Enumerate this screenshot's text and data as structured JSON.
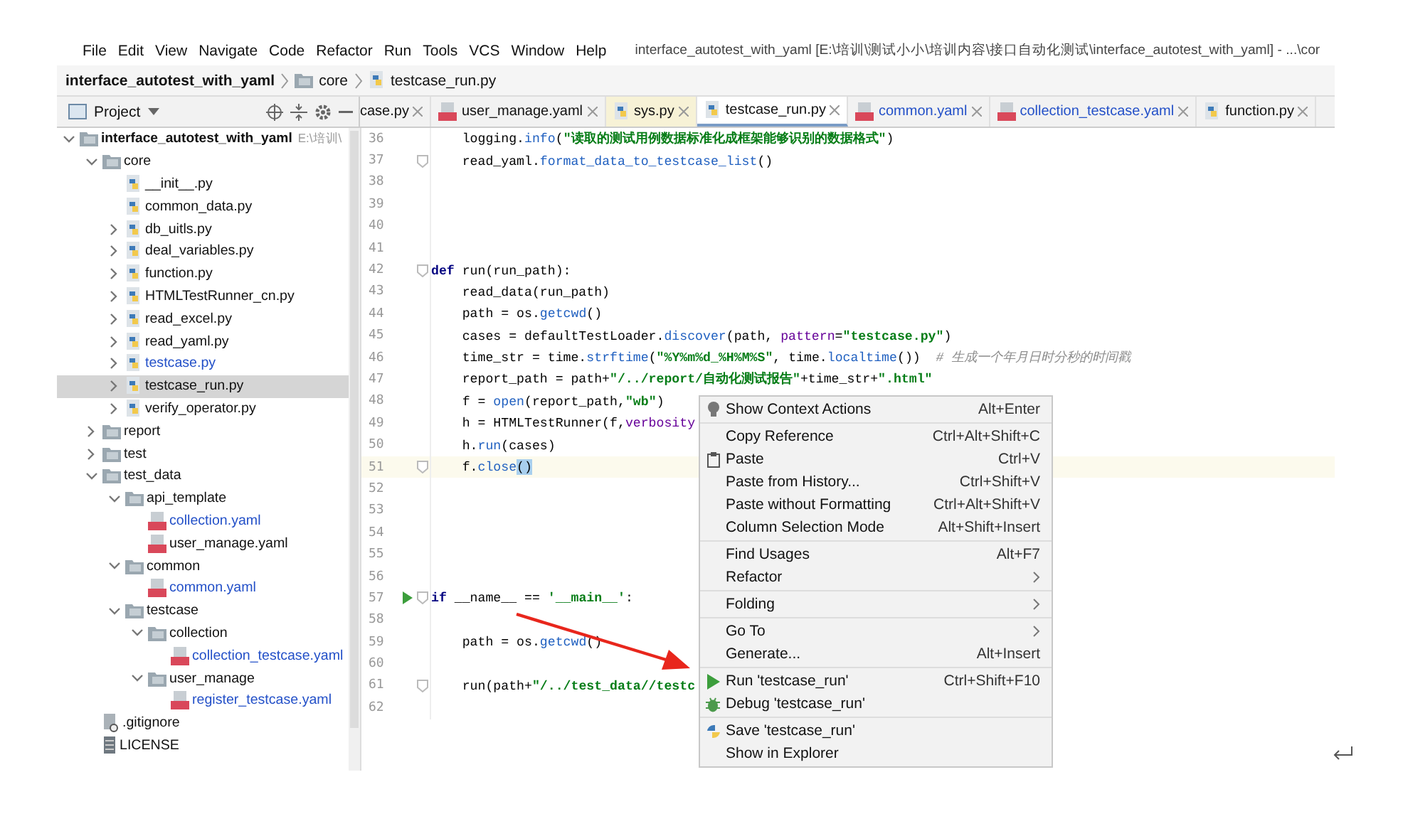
{
  "menu_bar": {
    "items": [
      "File",
      "Edit",
      "View",
      "Navigate",
      "Code",
      "Refactor",
      "Run",
      "Tools",
      "VCS",
      "Window",
      "Help"
    ],
    "title": "interface_autotest_with_yaml [E:\\培训\\测试小小\\培训内容\\接口自动化测试\\interface_autotest_with_yaml] - ...\\cor"
  },
  "breadcrumb": [
    "interface_autotest_with_yaml",
    "core",
    "testcase_run.py"
  ],
  "project_panel": {
    "title": "Project",
    "tree": [
      {
        "name": "interface_autotest_with_yaml",
        "hint": "E:\\培训\\",
        "kind": "folder",
        "expanded": true,
        "selected": false,
        "modified": false,
        "children": [
          {
            "name": "core",
            "kind": "folder",
            "expanded": true,
            "selected": false,
            "modified": false,
            "children": [
              {
                "name": "__init__.py",
                "kind": "py",
                "selected": false,
                "modified": false
              },
              {
                "name": "common_data.py",
                "kind": "py",
                "selected": false,
                "modified": false
              },
              {
                "name": "db_uitls.py",
                "kind": "py",
                "expanded": false,
                "selected": false,
                "modified": false
              },
              {
                "name": "deal_variables.py",
                "kind": "py",
                "expanded": false,
                "selected": false,
                "modified": false
              },
              {
                "name": "function.py",
                "kind": "py",
                "expanded": false,
                "selected": false,
                "modified": false
              },
              {
                "name": "HTMLTestRunner_cn.py",
                "kind": "py",
                "expanded": false,
                "selected": false,
                "modified": false
              },
              {
                "name": "read_excel.py",
                "kind": "py",
                "expanded": false,
                "selected": false,
                "modified": false
              },
              {
                "name": "read_yaml.py",
                "kind": "py",
                "expanded": false,
                "selected": false,
                "modified": false
              },
              {
                "name": "testcase.py",
                "kind": "py",
                "expanded": false,
                "selected": false,
                "modified": true
              },
              {
                "name": "testcase_run.py",
                "kind": "py",
                "expanded": false,
                "selected": true,
                "modified": false
              },
              {
                "name": "verify_operator.py",
                "kind": "py",
                "expanded": false,
                "selected": false,
                "modified": false
              }
            ]
          },
          {
            "name": "report",
            "kind": "folder",
            "expanded": false,
            "selected": false,
            "modified": false
          },
          {
            "name": "test",
            "kind": "folder",
            "expanded": false,
            "selected": false,
            "modified": false
          },
          {
            "name": "test_data",
            "kind": "folder",
            "expanded": true,
            "selected": false,
            "modified": false,
            "children": [
              {
                "name": "api_template",
                "kind": "folder",
                "expanded": true,
                "selected": false,
                "modified": false,
                "children": [
                  {
                    "name": "collection.yaml",
                    "kind": "yaml",
                    "selected": false,
                    "modified": true
                  },
                  {
                    "name": "user_manage.yaml",
                    "kind": "yaml",
                    "selected": false,
                    "modified": false
                  }
                ]
              },
              {
                "name": "common",
                "kind": "folder",
                "expanded": true,
                "selected": false,
                "modified": false,
                "children": [
                  {
                    "name": "common.yaml",
                    "kind": "yaml",
                    "selected": false,
                    "modified": true
                  }
                ]
              },
              {
                "name": "testcase",
                "kind": "folder",
                "expanded": true,
                "selected": false,
                "modified": false,
                "children": [
                  {
                    "name": "collection",
                    "kind": "folder",
                    "expanded": true,
                    "selected": false,
                    "modified": false,
                    "children": [
                      {
                        "name": "collection_testcase.yaml",
                        "kind": "yaml",
                        "selected": false,
                        "modified": true
                      }
                    ]
                  },
                  {
                    "name": "user_manage",
                    "kind": "folder",
                    "expanded": true,
                    "selected": false,
                    "modified": false,
                    "children": [
                      {
                        "name": "register_testcase.yaml",
                        "kind": "yaml",
                        "selected": false,
                        "modified": true
                      }
                    ]
                  }
                ]
              }
            ]
          },
          {
            "name": ".gitignore",
            "kind": "ignore",
            "selected": false,
            "modified": false
          },
          {
            "name": "LICENSE",
            "kind": "text",
            "selected": false,
            "modified": false
          }
        ]
      }
    ]
  },
  "tabs": [
    {
      "label": "case.py",
      "kind": "partial",
      "selected": false,
      "modified": false,
      "foreign": false
    },
    {
      "label": "user_manage.yaml",
      "kind": "yaml",
      "selected": false,
      "modified": false,
      "foreign": false
    },
    {
      "label": "sys.py",
      "kind": "py",
      "selected": false,
      "modified": false,
      "foreign": true
    },
    {
      "label": "testcase_run.py",
      "kind": "py",
      "selected": true,
      "modified": false,
      "foreign": false
    },
    {
      "label": "common.yaml",
      "kind": "yaml",
      "selected": false,
      "modified": true,
      "foreign": false
    },
    {
      "label": "collection_testcase.yaml",
      "kind": "yaml",
      "selected": false,
      "modified": true,
      "foreign": false
    },
    {
      "label": "function.py",
      "kind": "py",
      "selected": false,
      "modified": false,
      "foreign": false
    }
  ],
  "editor": {
    "lines": [
      {
        "number": "36",
        "current": false,
        "fold": false,
        "run": false,
        "tokens": [
          {
            "t": "    logging.",
            "kind": "plain"
          },
          {
            "t": "info",
            "kind": "fn"
          },
          {
            "t": "(",
            "kind": "plain"
          },
          {
            "t": "\"读取的测试用例数据标准化成框架能够识别的数据格式\"",
            "kind": "str"
          },
          {
            "t": ")",
            "kind": "plain"
          }
        ]
      },
      {
        "number": "37",
        "current": false,
        "fold": true,
        "run": false,
        "tokens": [
          {
            "t": "    read_yaml.",
            "kind": "plain"
          },
          {
            "t": "format_data_to_testcase_list",
            "kind": "fn"
          },
          {
            "t": "()",
            "kind": "plain"
          }
        ]
      },
      {
        "number": "38",
        "current": false,
        "fold": false,
        "run": false
      },
      {
        "number": "39",
        "current": false,
        "fold": false,
        "run": false
      },
      {
        "number": "40",
        "current": false,
        "fold": false,
        "run": false
      },
      {
        "number": "41",
        "current": false,
        "fold": false,
        "run": false
      },
      {
        "number": "42",
        "current": false,
        "fold": true,
        "run": false,
        "tokens": [
          {
            "t": "def ",
            "kind": "kw"
          },
          {
            "t": "run(run_path):",
            "kind": "plain"
          }
        ]
      },
      {
        "number": "43",
        "current": false,
        "fold": false,
        "run": false,
        "tokens": [
          {
            "t": "    read_data(run_path)",
            "kind": "plain"
          }
        ]
      },
      {
        "number": "44",
        "current": false,
        "fold": false,
        "run": false,
        "tokens": [
          {
            "t": "    path = os.",
            "kind": "plain"
          },
          {
            "t": "getcwd",
            "kind": "fn"
          },
          {
            "t": "()",
            "kind": "plain"
          }
        ]
      },
      {
        "number": "45",
        "current": false,
        "fold": false,
        "run": false,
        "tokens": [
          {
            "t": "    cases = defaultTestLoader.",
            "kind": "plain"
          },
          {
            "t": "discover",
            "kind": "fn"
          },
          {
            "t": "(path, ",
            "kind": "plain"
          },
          {
            "t": "pattern",
            "kind": "param"
          },
          {
            "t": "=",
            "kind": "plain"
          },
          {
            "t": "\"testcase.py\"",
            "kind": "str"
          },
          {
            "t": ")",
            "kind": "plain"
          }
        ]
      },
      {
        "number": "46",
        "current": false,
        "fold": false,
        "run": false,
        "tokens": [
          {
            "t": "    time_str = time.",
            "kind": "plain"
          },
          {
            "t": "strftime",
            "kind": "fn"
          },
          {
            "t": "(",
            "kind": "plain"
          },
          {
            "t": "\"%Y%m%d_%H%M%S\"",
            "kind": "str"
          },
          {
            "t": ", time.",
            "kind": "plain"
          },
          {
            "t": "localtime",
            "kind": "fn"
          },
          {
            "t": "())  ",
            "kind": "plain"
          },
          {
            "t": "# 生成一个年月日时分秒的时间戳",
            "kind": "comment"
          }
        ]
      },
      {
        "number": "47",
        "current": false,
        "fold": false,
        "run": false,
        "tokens": [
          {
            "t": "    report_path = path+",
            "kind": "plain"
          },
          {
            "t": "\"/../report/自动化测试报告\"",
            "kind": "str"
          },
          {
            "t": "+time_str+",
            "kind": "plain"
          },
          {
            "t": "\".html\"",
            "kind": "str"
          }
        ]
      },
      {
        "number": "48",
        "current": false,
        "fold": false,
        "run": false,
        "tokens": [
          {
            "t": "    f = ",
            "kind": "plain"
          },
          {
            "t": "open",
            "kind": "fn"
          },
          {
            "t": "(report_path,",
            "kind": "plain"
          },
          {
            "t": "\"wb\"",
            "kind": "str"
          },
          {
            "t": ")",
            "kind": "plain"
          }
        ]
      },
      {
        "number": "49",
        "current": false,
        "fold": false,
        "run": false,
        "tokens": [
          {
            "t": "    h = HTMLTestRunner(f,",
            "kind": "plain"
          },
          {
            "t": "verbosity",
            "kind": "param"
          }
        ]
      },
      {
        "number": "50",
        "current": false,
        "fold": false,
        "run": false,
        "tokens": [
          {
            "t": "    h.",
            "kind": "plain"
          },
          {
            "t": "run",
            "kind": "fn"
          },
          {
            "t": "(cases)",
            "kind": "plain"
          }
        ]
      },
      {
        "number": "51",
        "current": true,
        "fold": true,
        "run": false,
        "tokens": [
          {
            "t": "    f.",
            "kind": "plain"
          },
          {
            "t": "close",
            "kind": "fn"
          },
          {
            "t": "()",
            "kind": "brace"
          }
        ]
      },
      {
        "number": "52",
        "current": false,
        "fold": false,
        "run": false
      },
      {
        "number": "53",
        "current": false,
        "fold": false,
        "run": false
      },
      {
        "number": "54",
        "current": false,
        "fold": false,
        "run": false
      },
      {
        "number": "55",
        "current": false,
        "fold": false,
        "run": false
      },
      {
        "number": "56",
        "current": false,
        "fold": false,
        "run": false
      },
      {
        "number": "57",
        "current": false,
        "fold": true,
        "run": true,
        "tokens": [
          {
            "t": "if ",
            "kind": "kw"
          },
          {
            "t": "__name__ == ",
            "kind": "plain"
          },
          {
            "t": "'__main__'",
            "kind": "str"
          },
          {
            "t": ":",
            "kind": "plain"
          }
        ]
      },
      {
        "number": "58",
        "current": false,
        "fold": false,
        "run": false
      },
      {
        "number": "59",
        "current": false,
        "fold": false,
        "run": false,
        "tokens": [
          {
            "t": "    path = os.",
            "kind": "plain"
          },
          {
            "t": "getcwd",
            "kind": "fn"
          },
          {
            "t": "()",
            "kind": "plain"
          }
        ]
      },
      {
        "number": "60",
        "current": false,
        "fold": false,
        "run": false
      },
      {
        "number": "61",
        "current": false,
        "fold": true,
        "run": false,
        "tokens": [
          {
            "t": "    run(path+",
            "kind": "plain"
          },
          {
            "t": "\"/../test_data//testc",
            "kind": "str"
          }
        ]
      },
      {
        "number": "62",
        "current": false,
        "fold": false,
        "run": false
      }
    ]
  },
  "context_menu": {
    "groups": [
      [
        {
          "label": "Show Context Actions",
          "shortcut": "Alt+Enter",
          "kind": "bulb",
          "submenu": false
        }
      ],
      [
        {
          "label": "Copy Reference",
          "shortcut": "Ctrl+Alt+Shift+C",
          "submenu": false
        },
        {
          "label": "Paste",
          "shortcut": "Ctrl+V",
          "kind": "paste",
          "submenu": false
        },
        {
          "label": "Paste from History...",
          "shortcut": "Ctrl+Shift+V",
          "submenu": false
        },
        {
          "label": "Paste without Formatting",
          "shortcut": "Ctrl+Alt+Shift+V",
          "submenu": false
        },
        {
          "label": "Column Selection Mode",
          "shortcut": "Alt+Shift+Insert",
          "submenu": false
        }
      ],
      [
        {
          "label": "Find Usages",
          "shortcut": "Alt+F7",
          "submenu": false
        },
        {
          "label": "Refactor",
          "submenu": true
        }
      ],
      [
        {
          "label": "Folding",
          "submenu": true
        }
      ],
      [
        {
          "label": "Go To",
          "submenu": true
        },
        {
          "label": "Generate...",
          "shortcut": "Alt+Insert",
          "submenu": false
        }
      ],
      [
        {
          "label": "Run 'testcase_run'",
          "shortcut": "Ctrl+Shift+F10",
          "kind": "run",
          "submenu": false
        },
        {
          "label": "Debug 'testcase_run'",
          "kind": "debug",
          "submenu": false
        }
      ],
      [
        {
          "label": "Save 'testcase_run'",
          "kind": "python",
          "submenu": false
        },
        {
          "label": "Show in Explorer",
          "submenu": false
        }
      ]
    ]
  }
}
